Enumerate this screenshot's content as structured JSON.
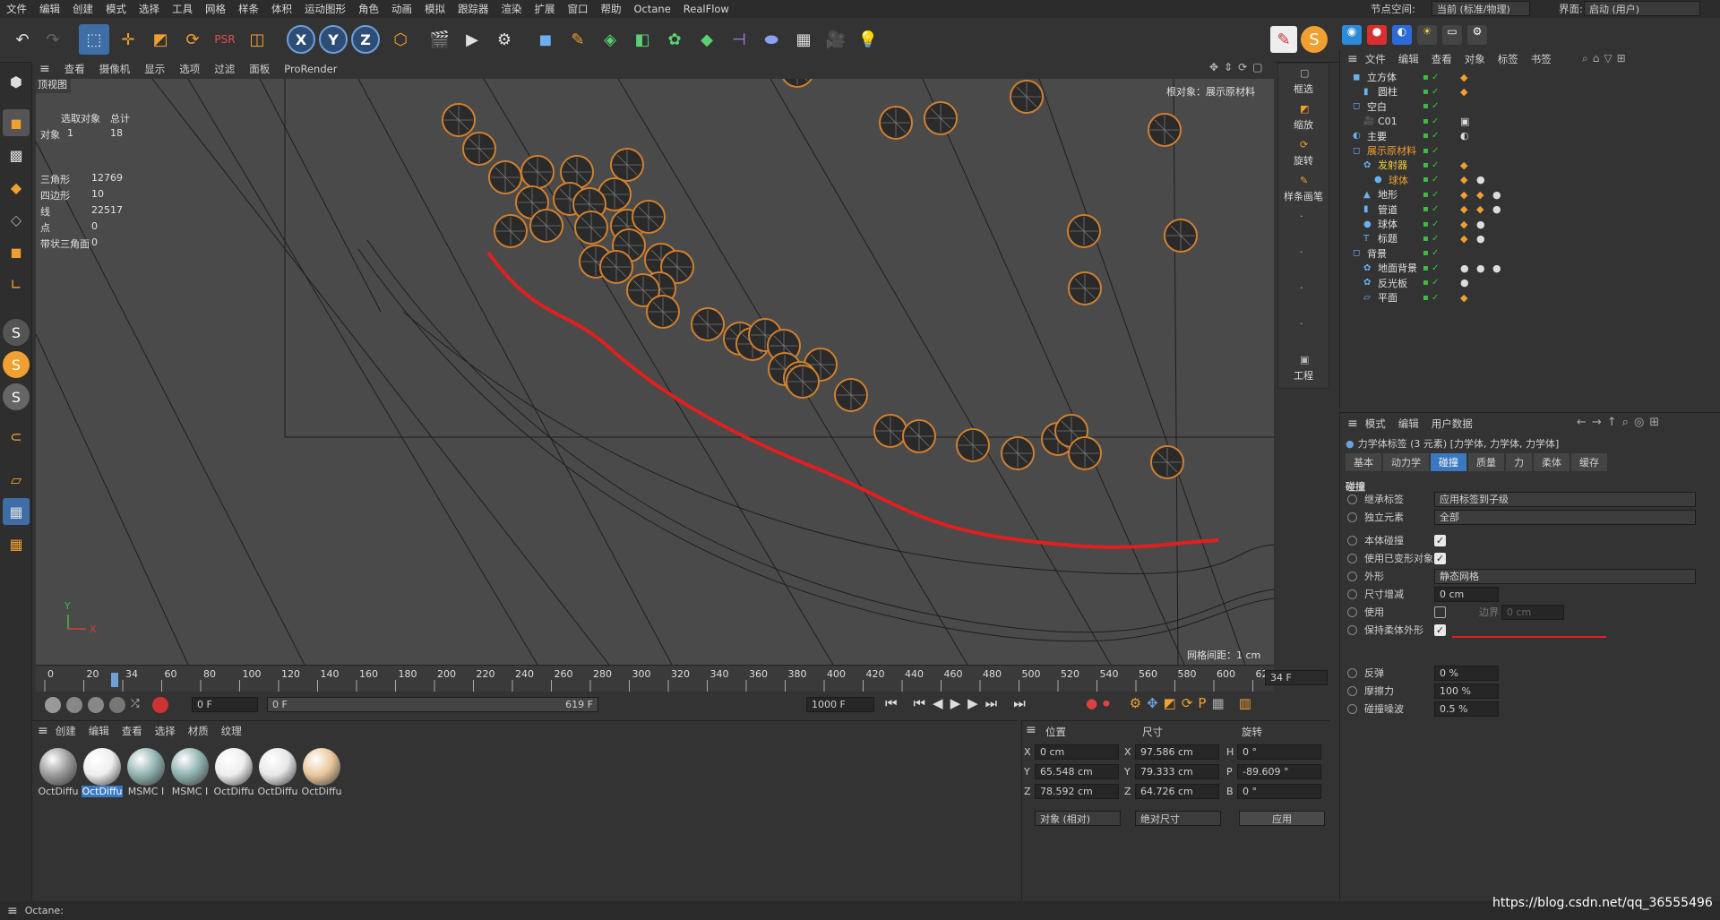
{
  "menu": [
    "文件",
    "编辑",
    "创建",
    "模式",
    "选择",
    "工具",
    "网格",
    "样条",
    "体积",
    "运动图形",
    "角色",
    "动画",
    "模拟",
    "跟踪器",
    "渲染",
    "扩展",
    "窗口",
    "帮助",
    "Octane",
    "RealFlow"
  ],
  "node_space": {
    "label": "节点空间:",
    "value": "当前 (标准/物理)"
  },
  "layout": {
    "label": "界面:",
    "value": "启动 (用户)"
  },
  "viewport": {
    "menu": [
      "查看",
      "摄像机",
      "显示",
      "选项",
      "过滤",
      "面板",
      "ProRender"
    ],
    "view_name": "顶视图",
    "root_label": "根对象：展示原材料",
    "grid_label": "网格间距：1 cm",
    "stats": {
      "hdr_selected": "选取对象",
      "hdr_total": "总计",
      "obj_label": "对象",
      "obj_sel": "1",
      "obj_total": "18",
      "tri_label": "三角形",
      "tri": "12769",
      "quad_label": "四边形",
      "quad": "10",
      "line_label": "线",
      "line": "22517",
      "point_label": "点",
      "point": "0",
      "strip_label": "带状三角面",
      "strip": "0"
    },
    "axis_y": "Y",
    "axis_x": "X"
  },
  "viewside": [
    "框选",
    "缩放",
    "旋转",
    "样条画笔",
    "工程"
  ],
  "timeline": {
    "ticks": [
      "0",
      "20",
      "34",
      "60",
      "80",
      "100",
      "120",
      "140",
      "160",
      "180",
      "200",
      "220",
      "240",
      "260",
      "280",
      "300",
      "320",
      "340",
      "360",
      "380",
      "400",
      "420",
      "440",
      "460",
      "480",
      "500",
      "520",
      "540",
      "560",
      "580",
      "600",
      "62"
    ],
    "current": "34 F",
    "frame_field": "0 F",
    "range_start": "0 F",
    "range_end": "619 F",
    "fps_field": "1000 F"
  },
  "materials": {
    "menu": [
      "创建",
      "编辑",
      "查看",
      "选择",
      "材质",
      "纹理"
    ],
    "items": [
      {
        "name": "OctDiffu",
        "color": "#9a9a9a"
      },
      {
        "name": "OctDiffu",
        "color": "#eeeeee"
      },
      {
        "name": "MSMC I",
        "color": "#8fb3b0"
      },
      {
        "name": "MSMC I",
        "color": "#8fb3b0"
      },
      {
        "name": "OctDiffu",
        "color": "#eeeeee"
      },
      {
        "name": "OctDiffu",
        "color": "#e8e8e8"
      },
      {
        "name": "OctDiffu",
        "color": "#e9c79b"
      }
    ]
  },
  "coords": {
    "hdr": [
      "位置",
      "尺寸",
      "旋转"
    ],
    "rows": [
      {
        "a": "X",
        "pos": "0 cm",
        "b": "X",
        "size": "97.586 cm",
        "c": "H",
        "rot": "0 °"
      },
      {
        "a": "Y",
        "pos": "65.548 cm",
        "b": "Y",
        "size": "79.333 cm",
        "c": "P",
        "rot": "-89.609 °"
      },
      {
        "a": "Z",
        "pos": "78.592 cm",
        "b": "Z",
        "size": "64.726 cm",
        "c": "B",
        "rot": "0 °"
      }
    ],
    "mode1": "对象 (相对)",
    "mode2": "绝对尺寸",
    "apply": "应用"
  },
  "objects": {
    "menu": [
      "文件",
      "编辑",
      "查看",
      "对象",
      "标签",
      "书签"
    ],
    "items": [
      {
        "name": "立方体",
        "indent": 0,
        "color": "#e0e0e0"
      },
      {
        "name": "圆柱",
        "indent": 1,
        "color": "#e0e0e0"
      },
      {
        "name": "空白",
        "indent": 0,
        "color": "#e0e0e0"
      },
      {
        "name": "C01",
        "indent": 1,
        "color": "#e0e0e0"
      },
      {
        "name": "主要",
        "indent": 0,
        "color": "#e0e0e0"
      },
      {
        "name": "展示原材料",
        "indent": 0,
        "color": "#f0a030"
      },
      {
        "name": "发射器",
        "indent": 1,
        "color": "#f0d040"
      },
      {
        "name": "球体",
        "indent": 2,
        "color": "#f0a030"
      },
      {
        "name": "地形",
        "indent": 1,
        "color": "#e0e0e0"
      },
      {
        "name": "管道",
        "indent": 1,
        "color": "#e0e0e0"
      },
      {
        "name": "球体",
        "indent": 1,
        "color": "#e0e0e0"
      },
      {
        "name": "标题",
        "indent": 1,
        "color": "#e0e0e0"
      },
      {
        "name": "背景",
        "indent": 0,
        "color": "#e0e0e0"
      },
      {
        "name": "地面背景",
        "indent": 1,
        "color": "#e0e0e0"
      },
      {
        "name": "反光板",
        "indent": 1,
        "color": "#e0e0e0"
      },
      {
        "name": "平面",
        "indent": 1,
        "color": "#e0e0e0"
      }
    ]
  },
  "attributes": {
    "menu": [
      "模式",
      "编辑",
      "用户数据"
    ],
    "title": "力学体标签 (3 元素) [力学体, 力学体, 力学体]",
    "tabs": [
      "基本",
      "动力学",
      "碰撞",
      "质量",
      "力",
      "柔体",
      "缓存"
    ],
    "active_tab": "碰撞",
    "section": "碰撞",
    "props": [
      {
        "label": "继承标签",
        "value": "应用标签到子级",
        "kind": "select"
      },
      {
        "label": "独立元素",
        "value": "全部",
        "kind": "select"
      },
      {
        "label": "本体碰撞",
        "value": "✓",
        "kind": "check"
      },
      {
        "label": "使用已变形对象",
        "value": "✓",
        "kind": "check"
      },
      {
        "label": "外形",
        "value": "静态网格",
        "kind": "select"
      },
      {
        "label": "尺寸增减",
        "value": "0 cm",
        "kind": "num"
      },
      {
        "label": "使用",
        "value": "",
        "kind": "check_empty"
      },
      {
        "label": "保持柔体外形",
        "value": "✓",
        "kind": "check"
      },
      {
        "label": "反弹",
        "value": "0 %",
        "kind": "num"
      },
      {
        "label": "摩擦力",
        "value": "100 %",
        "kind": "num"
      },
      {
        "label": "碰撞噪波",
        "value": "0.5 %",
        "kind": "num"
      }
    ],
    "border_label": "边界",
    "border_value": "0 cm"
  },
  "status": "Octane:",
  "watermark": "https://blog.csdn.net/qq_36555496"
}
